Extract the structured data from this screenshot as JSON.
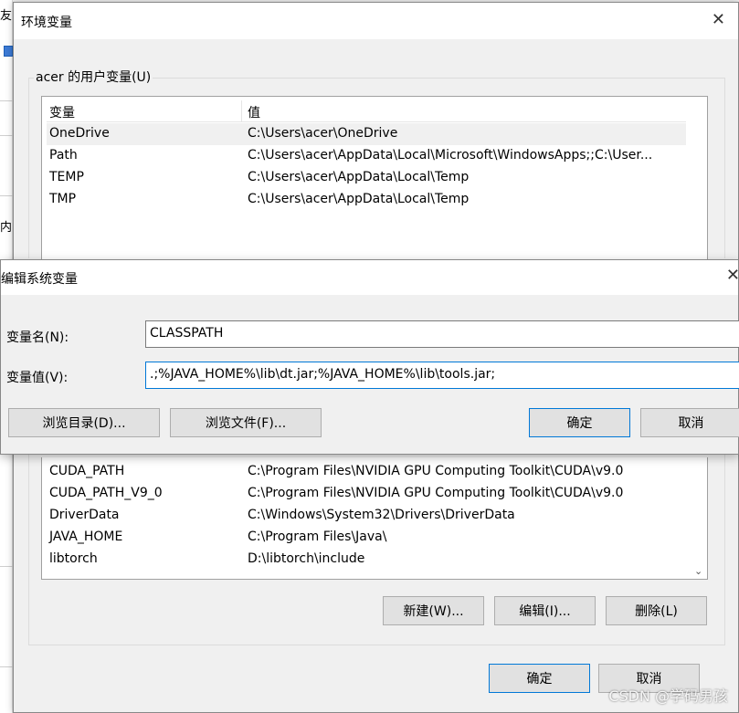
{
  "background_app": {
    "fragment_top": "友",
    "fragment_mid": "内"
  },
  "env_dialog": {
    "title": "环境变量",
    "user_group_label": "acer 的用户变量(U)",
    "columns": {
      "variable": "变量",
      "value": "值"
    },
    "user_vars": [
      {
        "name": "OneDrive",
        "value": "C:\\Users\\acer\\OneDrive"
      },
      {
        "name": "Path",
        "value": "C:\\Users\\acer\\AppData\\Local\\Microsoft\\WindowsApps;;C:\\User..."
      },
      {
        "name": "TEMP",
        "value": "C:\\Users\\acer\\AppData\\Local\\Temp"
      },
      {
        "name": "TMP",
        "value": "C:\\Users\\acer\\AppData\\Local\\Temp"
      }
    ],
    "system_vars": [
      {
        "name": "CUDA_PATH",
        "value": "C:\\Program Files\\NVIDIA GPU Computing Toolkit\\CUDA\\v9.0"
      },
      {
        "name": "CUDA_PATH_V9_0",
        "value": "C:\\Program Files\\NVIDIA GPU Computing Toolkit\\CUDA\\v9.0"
      },
      {
        "name": "DriverData",
        "value": "C:\\Windows\\System32\\Drivers\\DriverData"
      },
      {
        "name": "JAVA_HOME",
        "value": "C:\\Program Files\\Java\\"
      },
      {
        "name": "libtorch",
        "value": "D:\\libtorch\\include"
      }
    ],
    "sys_buttons": {
      "new": "新建(W)...",
      "edit": "编辑(I)...",
      "delete": "删除(L)"
    },
    "ok": "确定",
    "cancel": "取消"
  },
  "edit_dialog": {
    "title": "编辑系统变量",
    "name_label": "变量名(N):",
    "name_value": "CLASSPATH",
    "value_label": "变量值(V):",
    "value_value": ".;%JAVA_HOME%\\lib\\dt.jar;%JAVA_HOME%\\lib\\tools.jar;",
    "browse_dir": "浏览目录(D)...",
    "browse_file": "浏览文件(F)...",
    "ok": "确定",
    "cancel": "取消"
  },
  "watermark": "CSDN @学码男孩"
}
